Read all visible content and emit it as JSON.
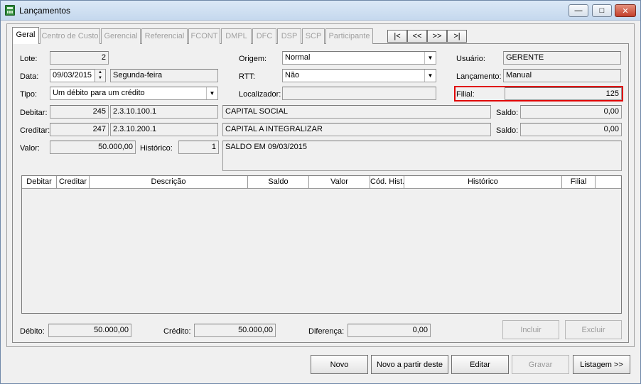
{
  "window": {
    "title": "Lançamentos",
    "minimize_glyph": "—",
    "maximize_glyph": "□",
    "close_glyph": "✕"
  },
  "tabs": [
    {
      "label": "Geral",
      "active": true
    },
    {
      "label": "Centro de Custo"
    },
    {
      "label": "Gerencial"
    },
    {
      "label": "Referencial"
    },
    {
      "label": "FCONT"
    },
    {
      "label": "DMPL"
    },
    {
      "label": "DFC"
    },
    {
      "label": "DSP"
    },
    {
      "label": "SCP"
    },
    {
      "label": "Participante"
    }
  ],
  "nav": {
    "first": "|<",
    "prev": "<<",
    "next": ">>",
    "last": ">|"
  },
  "form": {
    "lote": {
      "label": "Lote:",
      "value": "2"
    },
    "data": {
      "label": "Data:",
      "value": "09/03/2015",
      "weekday": "Segunda-feira"
    },
    "tipo": {
      "label": "Tipo:",
      "value": "Um débito para um crédito"
    },
    "debitar": {
      "label": "Debitar:",
      "code": "245",
      "account": "2.3.10.100.1",
      "name": "CAPITAL SOCIAL"
    },
    "creditar": {
      "label": "Creditar:",
      "code": "247",
      "account": "2.3.10.200.1",
      "name": "CAPITAL A INTEGRALIZAR"
    },
    "valor": {
      "label": "Valor:",
      "value": "50.000,00"
    },
    "historico": {
      "label": "Histórico:",
      "code": "1",
      "text": "SALDO EM 09/03/2015"
    },
    "origem": {
      "label": "Origem:",
      "value": "Normal"
    },
    "rtt": {
      "label": "RTT:",
      "value": "Não"
    },
    "localizador": {
      "label": "Localizador:",
      "value": ""
    },
    "usuario": {
      "label": "Usuário:",
      "value": "GERENTE"
    },
    "lancamento": {
      "label": "Lançamento:",
      "value": "Manual"
    },
    "filial": {
      "label": "Filial:",
      "value": "125"
    },
    "saldo_debito": {
      "label": "Saldo:",
      "value": "0,00"
    },
    "saldo_credito": {
      "label": "Saldo:",
      "value": "0,00"
    }
  },
  "grid": {
    "columns": [
      "Debitar",
      "Creditar",
      "Descrição",
      "Saldo",
      "Valor",
      "Cód. Hist.",
      "Histórico",
      "Filial"
    ],
    "rows": []
  },
  "totals": {
    "debito": {
      "label": "Débito:",
      "value": "50.000,00"
    },
    "credito": {
      "label": "Crédito:",
      "value": "50.000,00"
    },
    "diferenca": {
      "label": "Diferença:",
      "value": "0,00"
    }
  },
  "buttons": {
    "incluir": "Incluir",
    "excluir": "Excluir",
    "novo": "Novo",
    "novo_a_partir": "Novo a partir deste",
    "editar": "Editar",
    "gravar": "Gravar",
    "listagem": "Listagem >>"
  },
  "colors": {
    "highlight": "#e00000"
  }
}
